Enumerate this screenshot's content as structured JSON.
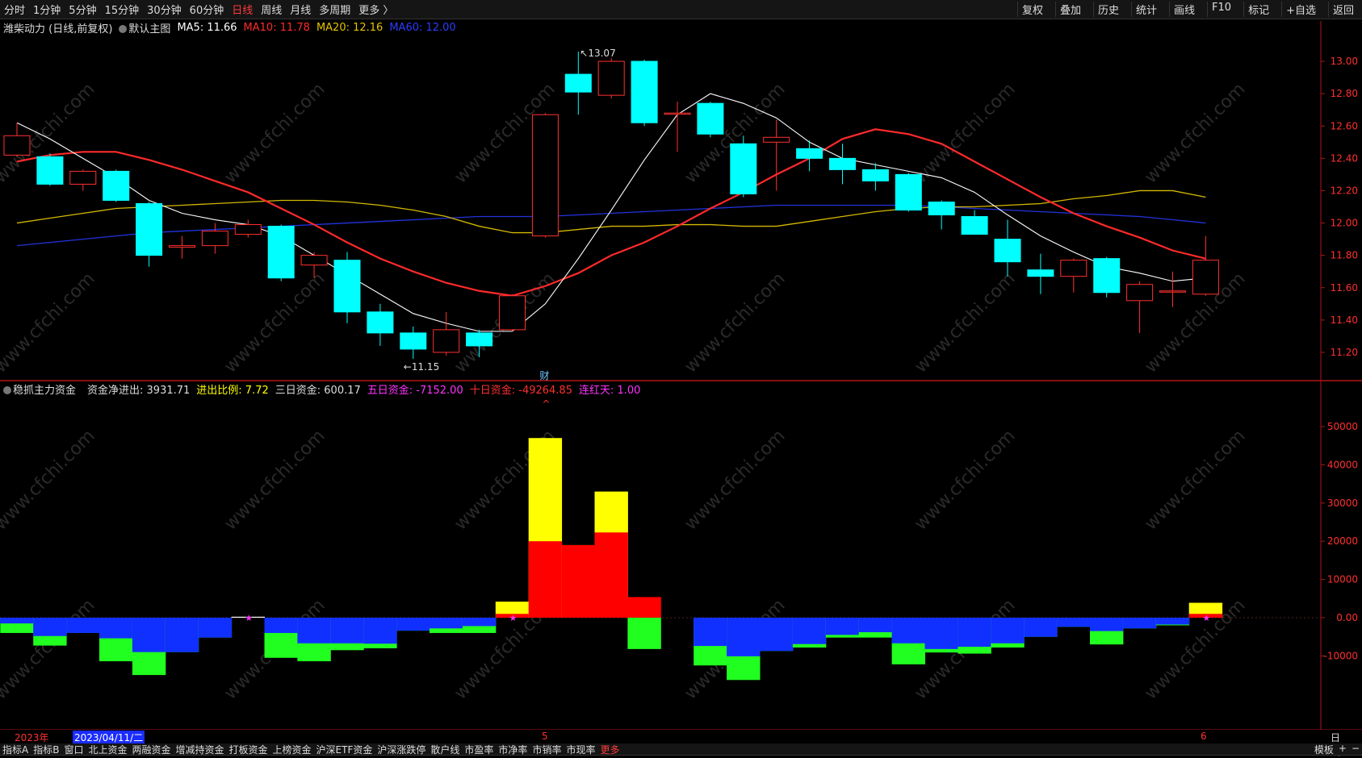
{
  "toolbar": {
    "periods": [
      "分时",
      "1分钟",
      "5分钟",
      "15分钟",
      "30分钟",
      "60分钟",
      "日线",
      "周线",
      "月线",
      "多周期",
      "更多 〉"
    ],
    "active_period": "日线",
    "tools": [
      "复权",
      "叠加",
      "历史",
      "统计",
      "画线",
      "F10",
      "标记",
      "+自选",
      "返回"
    ]
  },
  "main_panel": {
    "stock": "潍柴动力 (日线,前复权)",
    "mode": "默认主图",
    "ma": [
      {
        "label": "MA5: 11.66",
        "color": "#ffffff"
      },
      {
        "label": "MA10: 11.78",
        "color": "#ff2a2a"
      },
      {
        "label": "MA20: 12.16",
        "color": "#e6c200"
      },
      {
        "label": "MA60: 12.00",
        "color": "#2a3cff"
      }
    ],
    "high_label": "13.07",
    "low_label": "11.15",
    "event_marker": "财"
  },
  "sub_panel": {
    "name": "稳抓主力资金",
    "fields": [
      {
        "label": "资金净进出: 3931.71",
        "color": "#dddddd"
      },
      {
        "label": "进出比例: 7.72",
        "color": "#ffff00"
      },
      {
        "label": "三日资金: 600.17",
        "color": "#dddddd"
      },
      {
        "label": "五日资金: -7152.00",
        "color": "#ff33ff"
      },
      {
        "label": "十日资金: -49264.85",
        "color": "#ff3030"
      },
      {
        "label": "连红天: 1.00",
        "color": "#ff33ff"
      }
    ]
  },
  "date_bar": {
    "year": "2023年",
    "cursor_date": "2023/04/11/二",
    "m5": "5",
    "m6": "6",
    "period": "日线"
  },
  "bottom_tabs": [
    "指标A",
    "指标B",
    "窗口",
    "北上资金",
    "两融资金",
    "增减持资金",
    "打板资金",
    "上榜资金",
    "沪深ETF资金",
    "沪深涨跌停",
    "散户线",
    "市盈率",
    "市净率",
    "市销率",
    "市现率",
    "更多"
  ],
  "bottom_right": [
    "模板",
    "+",
    "−"
  ],
  "watermark": "www.cfchi.com",
  "colors": {
    "up": "#ff3030",
    "down": "#00ffff",
    "ma5": "#ffffff",
    "ma10": "#ff2a2a",
    "ma20": "#d4b800",
    "ma60": "#2233dd",
    "yellow": "#ffff00",
    "red": "#ff0000",
    "blue": "#1030ff",
    "green": "#20ff20"
  },
  "chart_data": [
    {
      "type": "candlestick",
      "ylim": [
        11.1,
        13.1
      ],
      "y_ticks": [
        "13.00",
        "12.80",
        "12.60",
        "12.40",
        "12.20",
        "12.00",
        "11.80",
        "11.60",
        "11.40",
        "11.20"
      ],
      "candles": [
        {
          "o": 12.42,
          "c": 12.54,
          "h": 12.62,
          "l": 12.41
        },
        {
          "o": 12.41,
          "c": 12.24,
          "h": 12.43,
          "l": 12.23
        },
        {
          "o": 12.24,
          "c": 12.32,
          "h": 12.33,
          "l": 12.2
        },
        {
          "o": 12.32,
          "c": 12.14,
          "h": 12.33,
          "l": 12.13
        },
        {
          "o": 12.12,
          "c": 11.8,
          "h": 12.13,
          "l": 11.73
        },
        {
          "o": 11.85,
          "c": 11.86,
          "h": 11.92,
          "l": 11.78
        },
        {
          "o": 11.86,
          "c": 11.95,
          "h": 12.0,
          "l": 11.81
        },
        {
          "o": 11.93,
          "c": 11.99,
          "h": 12.02,
          "l": 11.91
        },
        {
          "o": 11.98,
          "c": 11.66,
          "h": 11.99,
          "l": 11.64
        },
        {
          "o": 11.74,
          "c": 11.8,
          "h": 11.82,
          "l": 11.66
        },
        {
          "o": 11.77,
          "c": 11.45,
          "h": 11.82,
          "l": 11.38
        },
        {
          "o": 11.45,
          "c": 11.32,
          "h": 11.5,
          "l": 11.24
        },
        {
          "o": 11.32,
          "c": 11.22,
          "h": 11.36,
          "l": 11.16
        },
        {
          "o": 11.2,
          "c": 11.34,
          "h": 11.45,
          "l": 11.18
        },
        {
          "o": 11.32,
          "c": 11.24,
          "h": 11.34,
          "l": 11.17
        },
        {
          "o": 11.34,
          "c": 11.55,
          "h": 11.56,
          "l": 11.33
        },
        {
          "o": 11.92,
          "c": 12.67,
          "h": 12.68,
          "l": 11.91
        },
        {
          "o": 12.92,
          "c": 12.81,
          "h": 13.06,
          "l": 12.67
        },
        {
          "o": 12.79,
          "c": 13.0,
          "h": 13.02,
          "l": 12.77
        },
        {
          "o": 13.0,
          "c": 12.62,
          "h": 13.01,
          "l": 12.6
        },
        {
          "o": 12.68,
          "c": 12.68,
          "h": 12.75,
          "l": 12.44
        },
        {
          "o": 12.74,
          "c": 12.55,
          "h": 12.75,
          "l": 12.53
        },
        {
          "o": 12.49,
          "c": 12.18,
          "h": 12.54,
          "l": 12.16
        },
        {
          "o": 12.5,
          "c": 12.53,
          "h": 12.64,
          "l": 12.2
        },
        {
          "o": 12.46,
          "c": 12.4,
          "h": 12.51,
          "l": 12.32
        },
        {
          "o": 12.4,
          "c": 12.33,
          "h": 12.49,
          "l": 12.24
        },
        {
          "o": 12.33,
          "c": 12.26,
          "h": 12.37,
          "l": 12.2
        },
        {
          "o": 12.3,
          "c": 12.08,
          "h": 12.31,
          "l": 12.07
        },
        {
          "o": 12.13,
          "c": 12.05,
          "h": 12.14,
          "l": 11.96
        },
        {
          "o": 12.04,
          "c": 11.93,
          "h": 12.08,
          "l": 11.93
        },
        {
          "o": 11.9,
          "c": 11.76,
          "h": 12.02,
          "l": 11.67
        },
        {
          "o": 11.71,
          "c": 11.67,
          "h": 11.81,
          "l": 11.56
        },
        {
          "o": 11.67,
          "c": 11.77,
          "h": 11.78,
          "l": 11.57
        },
        {
          "o": 11.78,
          "c": 11.57,
          "h": 11.79,
          "l": 11.54
        },
        {
          "o": 11.52,
          "c": 11.62,
          "h": 11.64,
          "l": 11.32
        },
        {
          "o": 11.58,
          "c": 11.58,
          "h": 11.7,
          "l": 11.48
        },
        {
          "o": 11.56,
          "c": 11.77,
          "h": 11.92,
          "l": 11.55
        }
      ],
      "ma5": [
        12.62,
        12.52,
        12.4,
        12.28,
        12.14,
        12.06,
        12.02,
        11.99,
        11.92,
        11.8,
        11.68,
        11.56,
        11.44,
        11.38,
        11.33,
        11.33,
        11.5,
        11.78,
        12.08,
        12.39,
        12.67,
        12.8,
        12.74,
        12.65,
        12.5,
        12.4,
        12.36,
        12.32,
        12.28,
        12.19,
        12.05,
        11.92,
        11.82,
        11.73,
        11.69,
        11.64,
        11.66
      ],
      "ma10": [
        12.38,
        12.42,
        12.44,
        12.44,
        12.39,
        12.33,
        12.26,
        12.19,
        12.09,
        11.99,
        11.88,
        11.78,
        11.7,
        11.63,
        11.58,
        11.55,
        11.61,
        11.69,
        11.8,
        11.88,
        11.98,
        12.09,
        12.19,
        12.3,
        12.4,
        12.52,
        12.58,
        12.55,
        12.49,
        12.38,
        12.27,
        12.16,
        12.06,
        11.98,
        11.91,
        11.83,
        11.78
      ],
      "ma20": [
        12.0,
        12.03,
        12.06,
        12.09,
        12.1,
        12.11,
        12.12,
        12.13,
        12.14,
        12.14,
        12.13,
        12.11,
        12.08,
        12.04,
        11.98,
        11.94,
        11.94,
        11.96,
        11.98,
        11.98,
        11.99,
        11.99,
        11.98,
        11.98,
        12.01,
        12.04,
        12.07,
        12.09,
        12.1,
        12.1,
        12.11,
        12.12,
        12.15,
        12.17,
        12.2,
        12.2,
        12.16
      ],
      "ma60": [
        11.86,
        11.88,
        11.9,
        11.92,
        11.94,
        11.95,
        11.96,
        11.97,
        11.98,
        11.99,
        12.0,
        12.01,
        12.02,
        12.03,
        12.04,
        12.04,
        12.04,
        12.05,
        12.06,
        12.07,
        12.08,
        12.09,
        12.1,
        12.11,
        12.11,
        12.11,
        12.11,
        12.11,
        12.1,
        12.09,
        12.08,
        12.07,
        12.06,
        12.05,
        12.04,
        12.02,
        12.0
      ]
    },
    {
      "type": "bar",
      "ylim": [
        -20000,
        55000
      ],
      "y_ticks": [
        "50000",
        "40000",
        "30000",
        "20000",
        "10000",
        "0.00",
        "-10000"
      ],
      "bars": [
        {
          "blue": -1500,
          "green": -4000
        },
        {
          "blue": -4800,
          "green": -7300
        },
        {
          "blue": -4000,
          "green": -4000
        },
        {
          "blue": -5400,
          "green": -11400
        },
        {
          "blue": -9000,
          "green": -15000
        },
        {
          "blue": -9000,
          "green": -9000
        },
        {
          "blue": -5200,
          "green": -5200
        },
        {
          "blue": 0,
          "green": 0,
          "white": 250
        },
        {
          "blue": -4000,
          "green": -10500
        },
        {
          "blue": -6700,
          "green": -11400
        },
        {
          "blue": -6700,
          "green": -8500
        },
        {
          "blue": -6800,
          "green": -8000
        },
        {
          "blue": -3400,
          "green": -3400
        },
        {
          "blue": -2800,
          "green": -4000
        },
        {
          "blue": -2200,
          "green": -4000
        },
        {
          "red": 1000,
          "yellow": 4200
        },
        {
          "red": 20000,
          "yellow": 47000
        },
        {
          "red": 19000,
          "yellow": 19000
        },
        {
          "red": 22300,
          "yellow": 33000
        },
        {
          "blue": 0,
          "green": -8200,
          "red": 5400
        },
        {
          "blue": 0,
          "green": 0
        },
        {
          "blue": -7400,
          "green": -12500
        },
        {
          "blue": -10100,
          "green": -16300
        },
        {
          "blue": -8700,
          "green": -8700
        },
        {
          "blue": -6900,
          "green": -7800
        },
        {
          "blue": -4500,
          "green": -5200
        },
        {
          "blue": -3800,
          "green": -5200
        },
        {
          "blue": -6700,
          "green": -12200
        },
        {
          "blue": -8200,
          "green": -9100
        },
        {
          "blue": -7600,
          "green": -9400
        },
        {
          "blue": -6700,
          "green": -7800
        },
        {
          "blue": -5000,
          "green": -5000
        },
        {
          "blue": -2400,
          "green": -2400
        },
        {
          "blue": -3500,
          "green": -7000
        },
        {
          "blue": -2800,
          "green": -2800
        },
        {
          "blue": -1800,
          "green": -2000
        },
        {
          "red": 1000,
          "yellow": 3900
        }
      ]
    }
  ]
}
